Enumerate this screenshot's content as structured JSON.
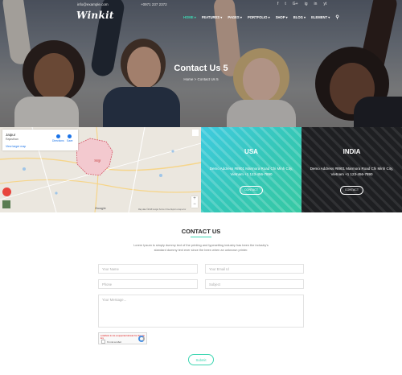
{
  "topbar": {
    "email": "info@example.com",
    "phone": "+0971 237 2372",
    "social": [
      "f",
      "t",
      "G+",
      "ig",
      "in",
      "yt"
    ]
  },
  "brand": {
    "logo": "Winkit"
  },
  "nav": {
    "items": [
      "HOME ▾",
      "FEATURES ▾",
      "PAGES ▾",
      "PORTFOLIO ▾",
      "SHOP ▾",
      "BLOG ▾",
      "ELEMENT ▾"
    ],
    "search_icon": "search-icon"
  },
  "hero": {
    "title": "Contact Us 5",
    "breadcrumb": "Home > Contact Us 5"
  },
  "map": {
    "place": "Jaipur",
    "region": "Rajasthan",
    "link": "View larger map",
    "directions": "Directions",
    "save": "Save",
    "city_label": "जयपुर",
    "brand": "Google",
    "footer": "Map data ©2018 Google  Terms of Use  Report a map error"
  },
  "offices": [
    {
      "country": "USA",
      "address": "Demo Address #8901 Marmora Road Chi Minh City, Vietnam +1 123-456-7890",
      "button": "CONTACT"
    },
    {
      "country": "INDIA",
      "address": "Demo Address #8901 Marmora Road Chi Minh City, Vietnam +1 123-456-7890",
      "button": "CONTACT"
    }
  ],
  "contact": {
    "title": "CONTACT US",
    "description": "Lorem Ipsum is simply dummy text of the printing and typesetting industry has been the industry's standard dummy text ever since the been when an unknown printer.",
    "name_placeholder": "Your Name",
    "email_placeholder": "Your Email Id",
    "phone_placeholder": "Phone",
    "subject_placeholder": "Subject",
    "message_placeholder": "Your Message...",
    "captcha_error": "Localhost is not a supported domain for this site key",
    "captcha_label": "I'm not a robot",
    "submit_label": "Submit"
  },
  "colors": {
    "accent": "#3ed6b2",
    "usa_panel": "#35c7b6",
    "india_panel": "#1e1f22"
  }
}
